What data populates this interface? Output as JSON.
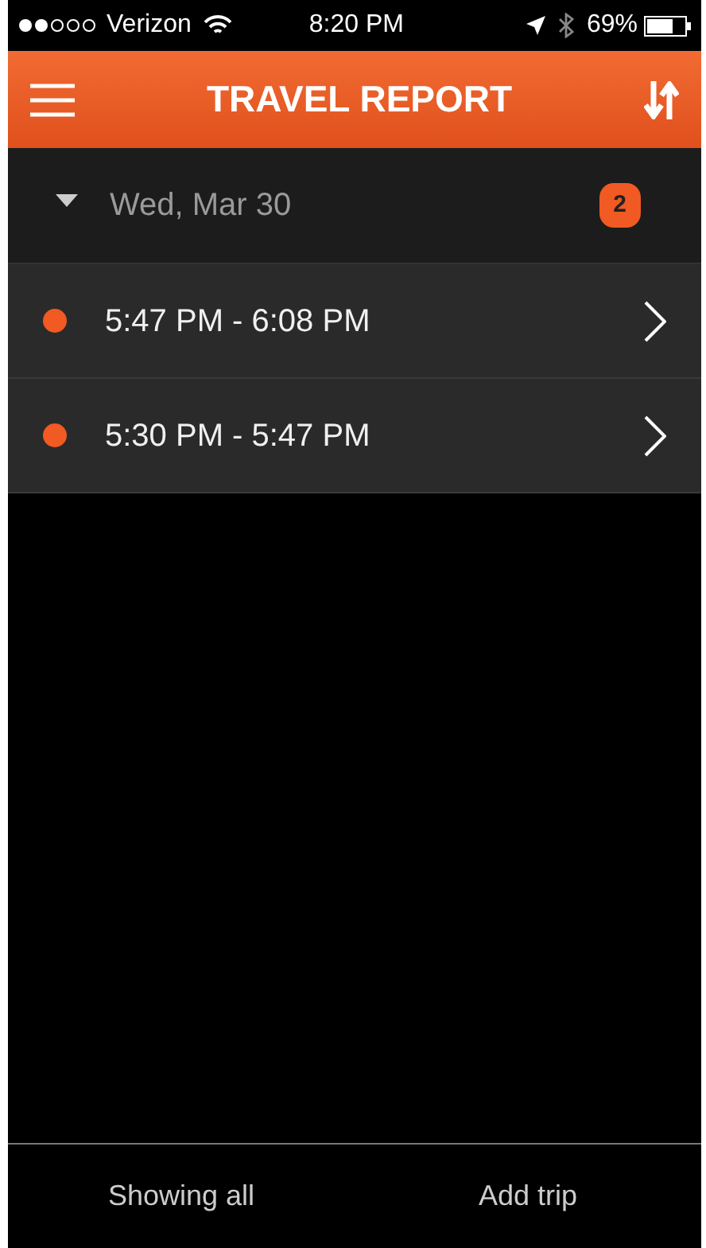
{
  "status_bar": {
    "carrier": "Verizon",
    "time": "8:20 PM",
    "battery": "69%"
  },
  "header": {
    "title": "TRAVEL REPORT"
  },
  "groups": [
    {
      "date": "Wed, Mar 30",
      "expanded": true,
      "count": "2",
      "trips": [
        {
          "time_range": "5:47 PM - 6:08 PM",
          "color": "#f15a22"
        },
        {
          "time_range": "5:30 PM - 5:47 PM",
          "color": "#f15a22"
        }
      ]
    }
  ],
  "footer": {
    "buttons": [
      "Showing all",
      "Add trip"
    ]
  }
}
